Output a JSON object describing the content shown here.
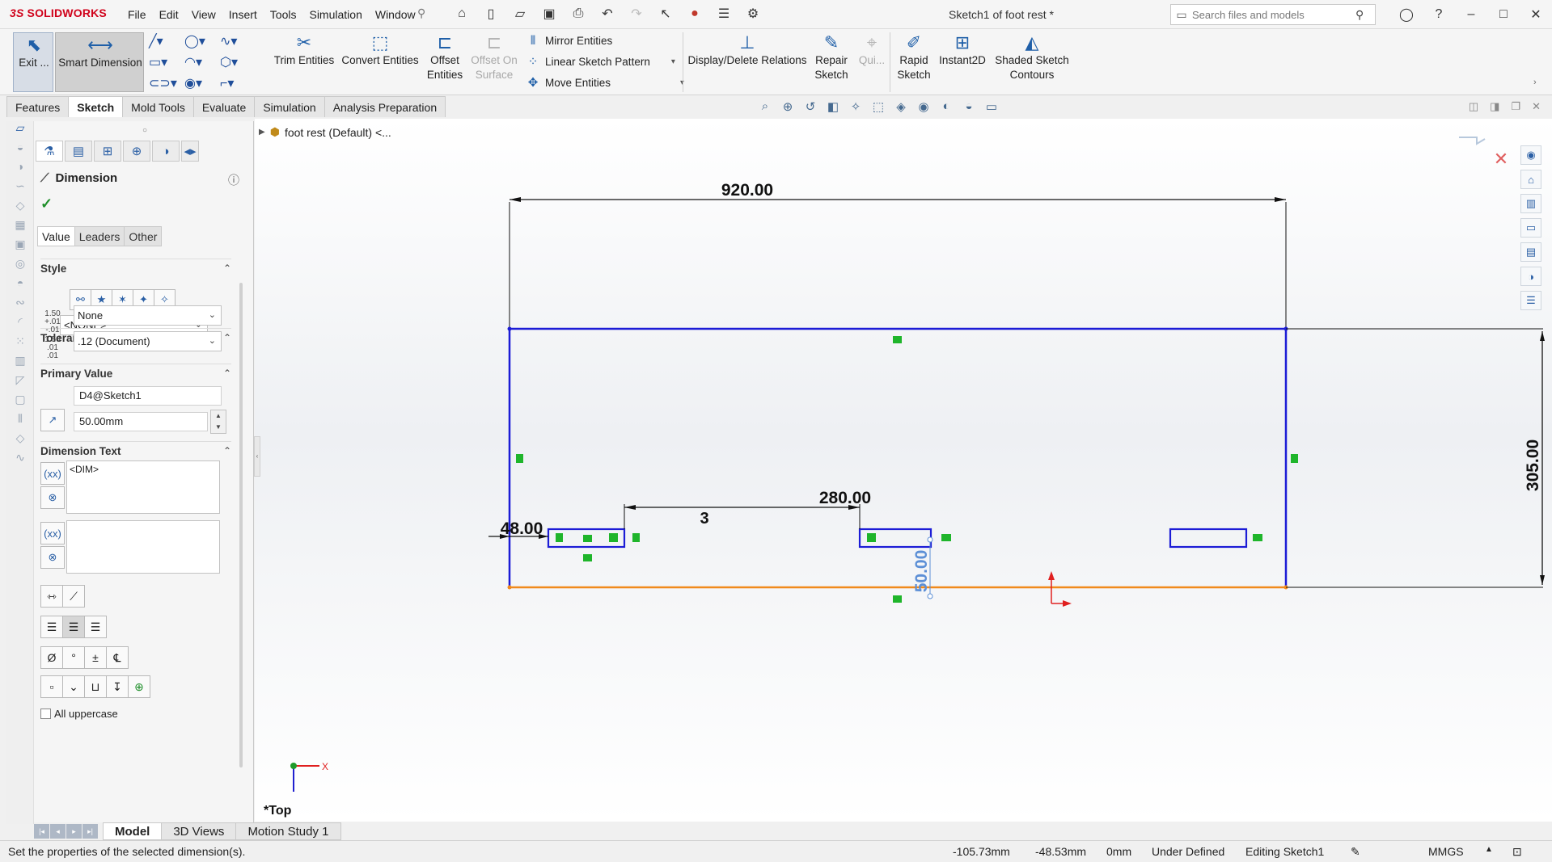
{
  "app": {
    "logo": "SOLIDWORKS",
    "logo_mark": "3S",
    "menus": [
      "File",
      "Edit",
      "View",
      "Insert",
      "Tools",
      "Simulation",
      "Window"
    ],
    "doc_title": "Sketch1 of foot rest *",
    "search_placeholder": "Search files and models"
  },
  "cmd": {
    "exit_label": "Exit ...",
    "smart_dimension_label": "Smart Dimension",
    "trim_label": "Trim Entities",
    "convert_label": "Convert Entities",
    "offset_label": "Offset\nEntities",
    "offset_surface_label": "Offset On\nSurface",
    "mirror_label": "Mirror Entities",
    "linear_pattern_label": "Linear Sketch Pattern",
    "move_label": "Move Entities",
    "display_delete_label": "Display/Delete Relations",
    "repair_label": "Repair\nSketch",
    "quick_label": "Qui...",
    "rapid_label": "Rapid\nSketch",
    "instant2d_label": "Instant2D",
    "shaded_label": "Shaded Sketch\nContours"
  },
  "tabs": [
    "Features",
    "Sketch",
    "Mold Tools",
    "Evaluate",
    "Simulation",
    "Analysis Preparation"
  ],
  "active_tab": "Sketch",
  "tree": {
    "label": "foot rest (Default) <..."
  },
  "pm": {
    "title": "Dimension",
    "subtabs": [
      "Value",
      "Leaders",
      "Other"
    ],
    "style_header": "Style",
    "style_value": "<NONE>",
    "tolerance_header": "Tolerance/Precision",
    "tolerance_value": "None",
    "precision_value": ".12 (Document)",
    "tol_icon_text": "1.50 +.01 -.01",
    "prec_icon_text": "1.50 .01 .01",
    "primary_header": "Primary Value",
    "primary_name": "D4@Sketch1",
    "primary_value": "50.00mm",
    "dimtext_header": "Dimension Text",
    "dimtext_value": "<DIM>",
    "uppercase_label": "All uppercase"
  },
  "sketch": {
    "dims": {
      "top": "920.00",
      "right": "305.00",
      "slot_gap": "280.00",
      "left": "48.00",
      "editing": "50.00",
      "count": "3"
    }
  },
  "view_label": "*Top",
  "bottom_tabs": [
    "Model",
    "3D Views",
    "Motion Study 1"
  ],
  "active_bottom_tab": "Model",
  "status": {
    "message": "Set the properties of the selected dimension(s).",
    "x": "-105.73mm",
    "y": "-48.53mm",
    "z": "0mm",
    "state": "Under Defined",
    "editing": "Editing Sketch1",
    "units": "MMGS"
  },
  "colors": {
    "sketch_blue": "#1c1cd6",
    "origin_orange": "#f08a1c",
    "relation_green": "#1fb52b",
    "dim_editing": "#5c8fd6",
    "logo_red": "#d0021b"
  }
}
